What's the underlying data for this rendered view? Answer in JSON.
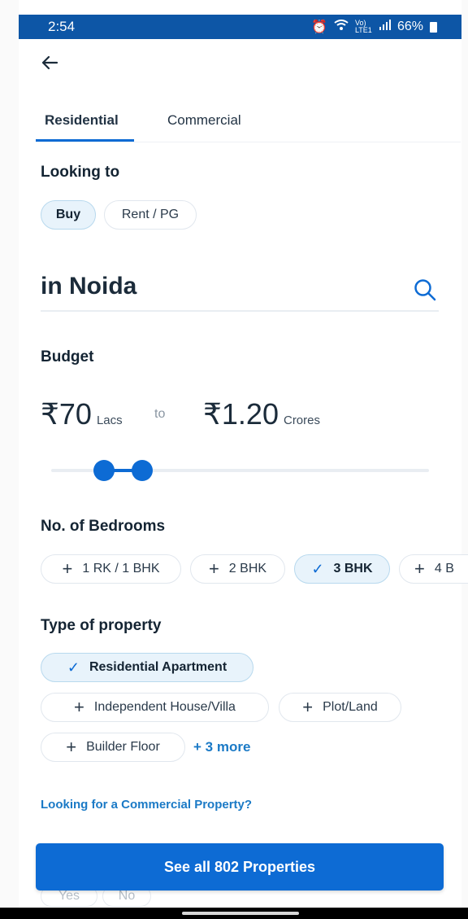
{
  "status": {
    "time": "2:54",
    "network": "Vo) LTE1",
    "battery": "66%"
  },
  "tabs": [
    {
      "label": "Residential"
    },
    {
      "label": "Commercial"
    }
  ],
  "looking_to": {
    "title": "Looking to",
    "options": [
      {
        "label": "Buy",
        "selected": true
      },
      {
        "label": "Rent / PG",
        "selected": false
      }
    ]
  },
  "location": {
    "city": "in Noida"
  },
  "budget": {
    "title": "Budget",
    "min_currency": "₹",
    "min_value": "70",
    "min_unit": "Lacs",
    "to_label": "to",
    "max_currency": "₹",
    "max_value": "1.20",
    "max_unit": "Crores",
    "slider_min_fraction": 0.14,
    "slider_max_fraction": 0.24
  },
  "bedrooms": {
    "title": "No. of Bedrooms",
    "options": [
      {
        "label": "1 RK / 1 BHK",
        "selected": false
      },
      {
        "label": "2 BHK",
        "selected": false
      },
      {
        "label": "3 BHK",
        "selected": true
      },
      {
        "label": "4 B",
        "selected": false
      }
    ]
  },
  "property_type": {
    "title": "Type of property",
    "options": [
      {
        "label": "Residential Apartment",
        "selected": true
      },
      {
        "label": "Independent House/Villa",
        "selected": false
      },
      {
        "label": "Plot/Land",
        "selected": false
      },
      {
        "label": "Builder Floor",
        "selected": false
      }
    ],
    "more_label": "+ 3 more"
  },
  "commercial_link": "Looking for a Commercial Property?",
  "cta_label": "See all 802 Properties",
  "peek_options": [
    "Yes",
    "No"
  ],
  "colors": {
    "accent": "#0d6bd4",
    "status_bar": "#0d56a6",
    "chip_selected": "#e8f3fb",
    "link": "#1b7ac6"
  }
}
